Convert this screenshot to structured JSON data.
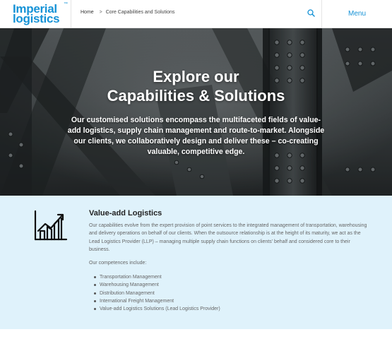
{
  "header": {
    "logo": {
      "line1": "Imperial",
      "line2": "logistics",
      "tm": "™"
    },
    "breadcrumb": {
      "home": "Home",
      "separator": ">",
      "current": "Core Capabilities and Solutions"
    },
    "search_icon": "search-icon",
    "menu_label": "Menu"
  },
  "hero": {
    "title_line1": "Explore our",
    "title_line2": "Capabilities & Solutions",
    "text": "Our customised solutions encompass the multifaceted fields of value-add logistics, supply chain management and route-to-market. Alongside our clients, we collaboratively design and deliver these – co-creating valuable, competitive edge."
  },
  "section": {
    "icon": "growth-chart-icon",
    "title": "Value-add Logistics",
    "description": "Our capabilities evolve from the expert provision of point services to the integrated management of transportation, warehousing and delivery operations on behalf of our clients. When the outsource relationship is at the height of its maturity, we act as the Lead Logistics Provider (LLP) – managing multiple supply chain functions on clients’ behalf and considered core to their business.",
    "competences_label": "Our competences include:",
    "competences": [
      "Transportation Management",
      "Warehousing Management",
      "Distribution Management",
      "International Freight Management",
      "Value-add Logistics Solutions (Lead Logistics Provider)"
    ]
  },
  "colors": {
    "brand": "#1592d6",
    "section_bg": "#dff2fb",
    "hero_bg": "#2f3436"
  }
}
